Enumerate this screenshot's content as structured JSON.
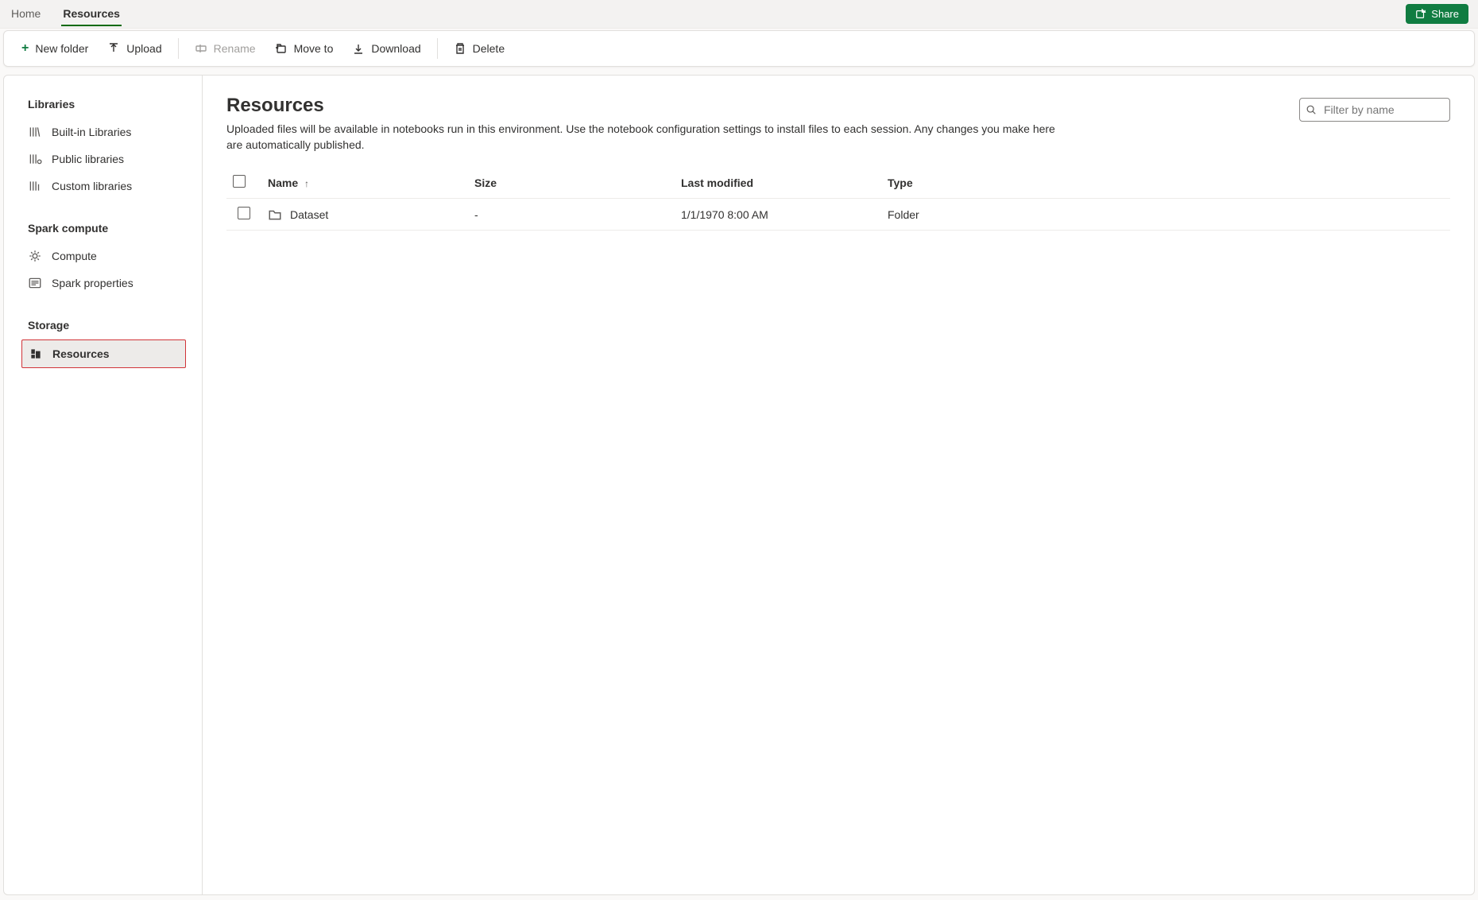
{
  "top_tabs": {
    "home": "Home",
    "resources": "Resources"
  },
  "share_label": "Share",
  "toolbar": {
    "new_folder": "New folder",
    "upload": "Upload",
    "rename": "Rename",
    "move_to": "Move to",
    "download": "Download",
    "delete": "Delete"
  },
  "sidebar": {
    "libraries": {
      "title": "Libraries",
      "builtin": "Built-in Libraries",
      "public": "Public libraries",
      "custom": "Custom libraries"
    },
    "spark": {
      "title": "Spark compute",
      "compute": "Compute",
      "properties": "Spark properties"
    },
    "storage": {
      "title": "Storage",
      "resources": "Resources"
    }
  },
  "page": {
    "title": "Resources",
    "description": "Uploaded files will be available in notebooks run in this environment. Use the notebook configuration settings to install files to each session. Any changes you make here are automatically published."
  },
  "search": {
    "placeholder": "Filter by name"
  },
  "table": {
    "headers": {
      "name": "Name",
      "size": "Size",
      "modified": "Last modified",
      "type": "Type"
    },
    "rows": [
      {
        "name": "Dataset",
        "size": "-",
        "modified": "1/1/1970 8:00 AM",
        "type": "Folder"
      }
    ]
  }
}
